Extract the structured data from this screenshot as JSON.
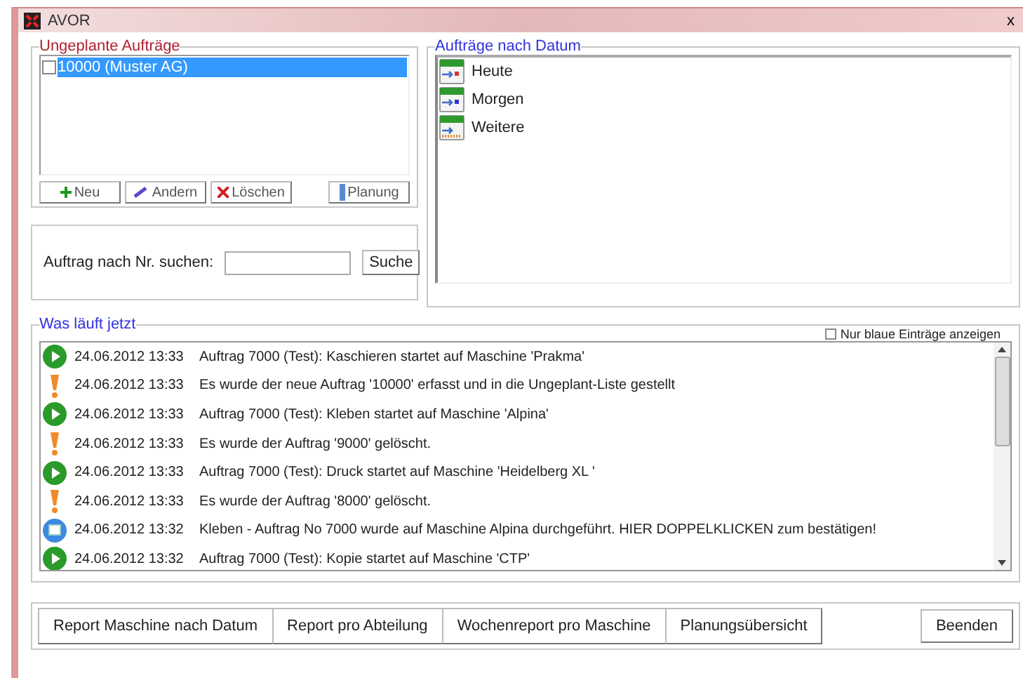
{
  "window": {
    "title": "AVOR",
    "close": "x"
  },
  "unplanned": {
    "title": "Ungeplante Aufträge",
    "items": [
      {
        "label": "10000 (Muster AG)",
        "checked": false,
        "selected": true
      }
    ],
    "buttons": [
      {
        "label": "Neu",
        "kind": "add"
      },
      {
        "label": "Andern",
        "kind": "edit"
      },
      {
        "label": "Löschen",
        "kind": "delete"
      },
      {
        "label": "Planung",
        "kind": "plan"
      }
    ]
  },
  "search": {
    "label": "Auftrag nach Nr. suchen:",
    "button": "Suche"
  },
  "by_date": {
    "title": "Aufträge nach Datum",
    "items": [
      {
        "label": "Heute",
        "kind": "today"
      },
      {
        "label": "Morgen",
        "kind": "tomorrow"
      },
      {
        "label": "Weitere",
        "kind": "later"
      }
    ]
  },
  "log": {
    "title": "Was läuft jetzt",
    "filter": {
      "label": "Nur blaue Einträge anzeigen",
      "checked": false
    },
    "entries": [
      {
        "kind": "start",
        "time": "24.06.2012 13:33",
        "text": "Auftrag 7000 (Test): Kaschieren startet auf Maschine 'Prakma'"
      },
      {
        "kind": "warn",
        "time": "24.06.2012 13:33",
        "text": "Es wurde der neue Auftrag '10000' erfasst und in die Ungeplant-Liste gestellt"
      },
      {
        "kind": "start",
        "time": "24.06.2012 13:33",
        "text": "Auftrag 7000 (Test): Kleben startet auf Maschine 'Alpina'"
      },
      {
        "kind": "warn",
        "time": "24.06.2012 13:33",
        "text": "Es wurde der Auftrag '9000' gelöscht."
      },
      {
        "kind": "start",
        "time": "24.06.2012 13:33",
        "text": "Auftrag 7000 (Test): Druck startet auf Maschine 'Heidelberg XL '"
      },
      {
        "kind": "warn",
        "time": "24.06.2012 13:33",
        "text": "Es wurde der Auftrag '8000' gelöscht."
      },
      {
        "kind": "info",
        "time": "24.06.2012 13:32",
        "text": "Kleben - Auftrag No 7000 wurde auf Maschine Alpina durchgeführt. HIER DOPPELKLICKEN zum bestätigen!"
      },
      {
        "kind": "start",
        "time": "24.06.2012 13:32",
        "text": "Auftrag 7000 (Test): Kopie startet auf Maschine 'CTP'"
      }
    ]
  },
  "footer": {
    "reports": [
      "Report Maschine nach Datum",
      "Report pro Abteilung",
      "Wochenreport pro Maschine",
      "Planungsübersicht"
    ],
    "exit": "Beenden"
  }
}
